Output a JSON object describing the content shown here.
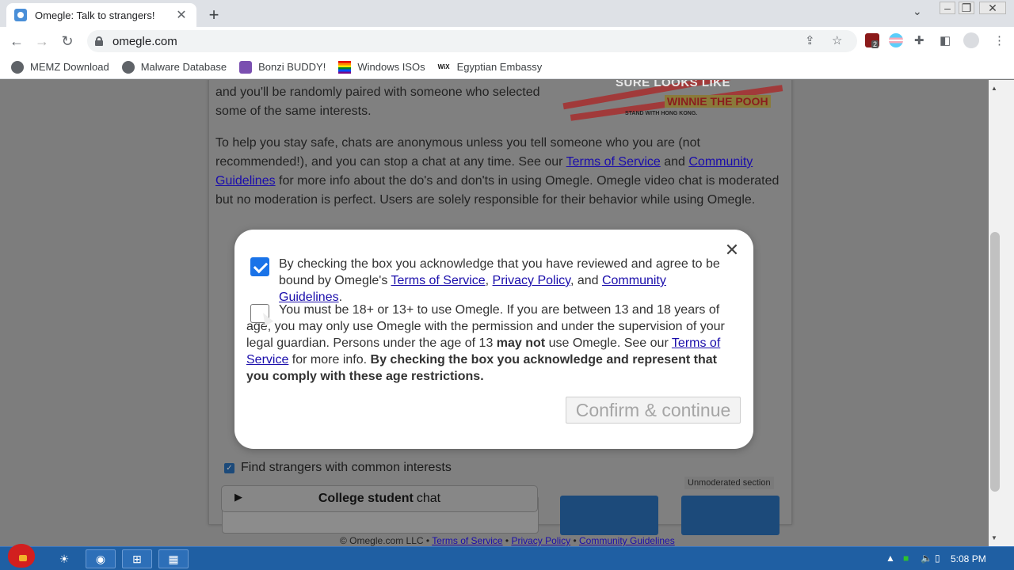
{
  "browser": {
    "tab_title": "Omegle: Talk to strangers!",
    "url": "omegle.com",
    "extension_badge": "2",
    "bookmarks": [
      {
        "label": "MEMZ Download"
      },
      {
        "label": "Malware Database"
      },
      {
        "label": "Bonzi BUDDY!"
      },
      {
        "label": "Windows ISOs"
      },
      {
        "label": "Egyptian Embassy"
      }
    ]
  },
  "page": {
    "intro_line1": "and you'll be randomly paired with someone who selected",
    "intro_line2": "some of the same interests.",
    "safety_pre": "To help you stay safe, chats are anonymous unless you tell someone who you are (not recommended!), and you can stop a chat at any time. See our ",
    "safety_tos": "Terms of Service",
    "safety_and": " and ",
    "safety_cg": "Community Guidelines",
    "safety_post": " for more info about the do's and don'ts in using Omegle. Omegle video chat is moderated but no moderation is perfect. Users are solely responsible for their behavior while using Omegle.",
    "banner_line1": "SURE LOOKS LIKE",
    "banner_line2": "WINNIE THE POOH",
    "banner_line3": "STAND WITH HONG KONG.",
    "interests_label": "Find strangers with common interests",
    "unmoderated_label": "Unmoderated section",
    "college_bold": "College student",
    "college_rest": "chat",
    "footer_copyright": "© Omegle.com LLC • ",
    "footer_tos": "Terms of Service",
    "footer_sep": " • ",
    "footer_privacy": "Privacy Policy",
    "footer_cg": "Community Guidelines"
  },
  "modal": {
    "check1_pre": "By checking the box you acknowledge that you have reviewed and agree to be bound by Omegle's ",
    "check1_tos": "Terms of Service",
    "check1_comma": ", ",
    "check1_privacy": "Privacy Policy",
    "check1_and": ", and ",
    "check1_cg": "Community Guidelines",
    "check1_end": ".",
    "check1_checked": true,
    "check2_pre": "You must be 18+ or 13+ to use Omegle. If you are between 13 and 18 years of age, you may only use Omegle with the permission and under the supervision of your legal guardian. Persons under the age of 13 ",
    "check2_bold1": "may not",
    "check2_mid": " use Omegle. See our ",
    "check2_tos": "Terms of Service",
    "check2_after": " for more info. ",
    "check2_bold2": "By checking the box you acknowledge and represent that you comply with these age restrictions.",
    "check2_checked": false,
    "confirm_label": "Confirm & continue"
  },
  "taskbar": {
    "clock": "5:08 PM"
  },
  "colors": {
    "accent": "#1a73e8",
    "link": "#1a0dab",
    "taskbar": "#1f5fa3"
  }
}
